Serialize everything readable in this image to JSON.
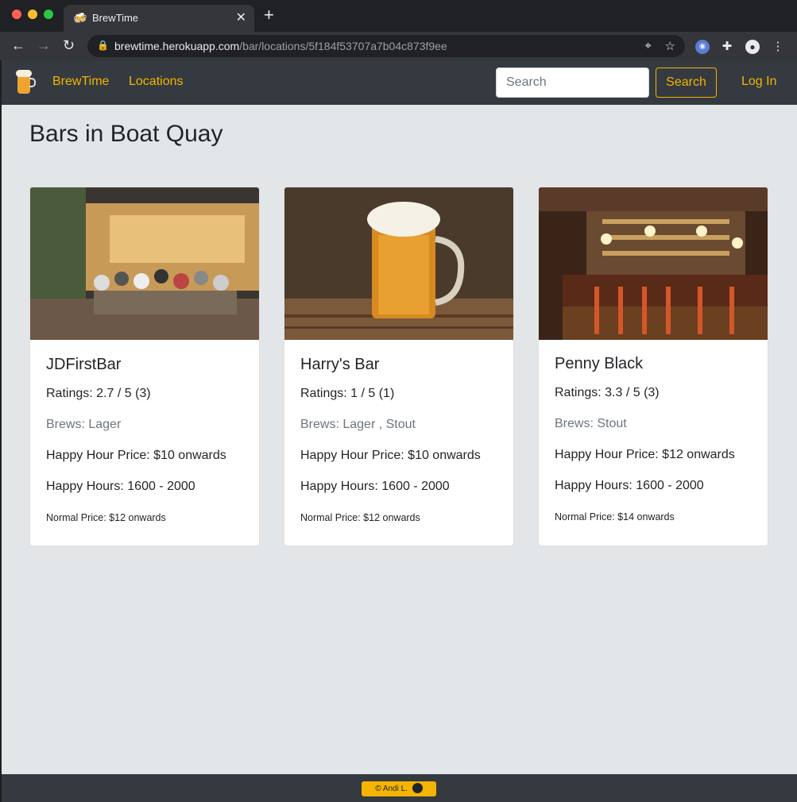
{
  "browser": {
    "tab_title": "BrewTime",
    "tab_favicon": "🍻",
    "url_host": "brewtime.herokuapp.com",
    "url_path": "/bar/locations/5f184f53707a7b04c873f9ee"
  },
  "navbar": {
    "brand": "BrewTime",
    "locations": "Locations",
    "search_placeholder": "Search",
    "search_button": "Search",
    "login": "Log In"
  },
  "page_title": "Bars in Boat Quay",
  "bars": [
    {
      "name": "JDFirstBar",
      "rating": "Ratings: 2.7 / 5 (3)",
      "brews": "Brews: Lager",
      "happy_hour_price": "Happy Hour Price: $10 onwards",
      "happy_hours": "Happy Hours: 1600 - 2000",
      "normal_price": "Normal Price: $12 onwards"
    },
    {
      "name": "Harry's Bar",
      "rating": "Ratings: 1 / 5 (1)",
      "brews": "Brews: Lager , Stout",
      "happy_hour_price": "Happy Hour Price: $10 onwards",
      "happy_hours": "Happy Hours: 1600 - 2000",
      "normal_price": "Normal Price: $12 onwards"
    },
    {
      "name": "Penny Black",
      "rating": "Ratings: 3.3 / 5 (3)",
      "brews": "Brews: Stout",
      "happy_hour_price": "Happy Hour Price: $12 onwards",
      "happy_hours": "Happy Hours: 1600 - 2000",
      "normal_price": "Normal Price: $14 onwards"
    }
  ],
  "footer": {
    "credit": "© Andi L."
  },
  "colors": {
    "accent": "#f4b400",
    "navbar": "#343a40",
    "page_bg": "#e3e6e8"
  }
}
